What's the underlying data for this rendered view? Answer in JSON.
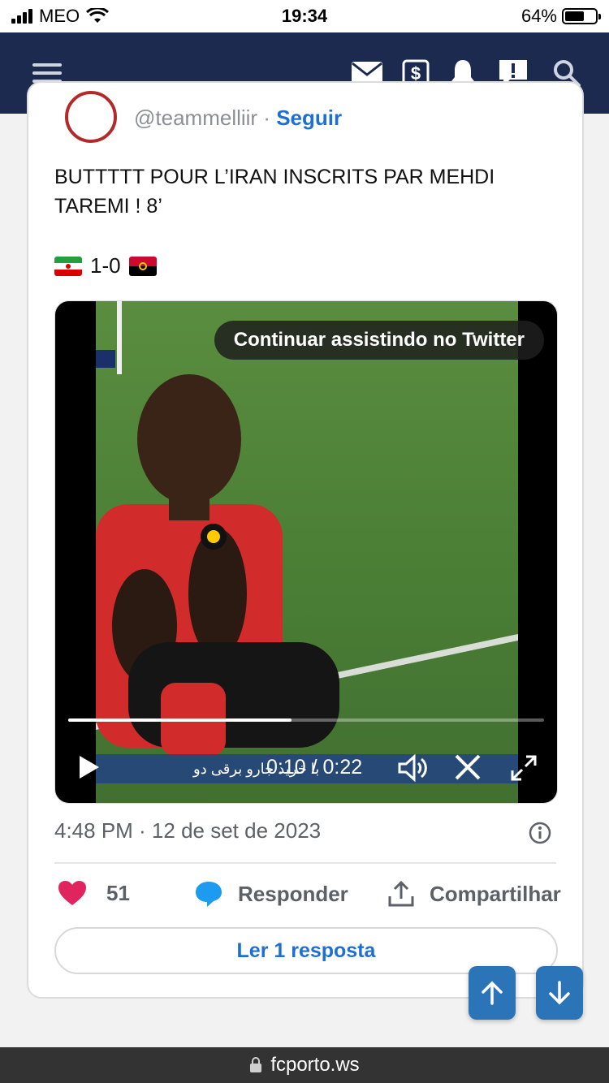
{
  "status_bar": {
    "carrier": "MEO",
    "time": "19:34",
    "battery": "64%"
  },
  "navbar": {
    "icons": [
      "menu-icon",
      "mail-icon",
      "dollar-icon",
      "bell-icon",
      "alert-icon",
      "search-icon"
    ]
  },
  "tweet": {
    "handle": "@teammelliir",
    "separator": " · ",
    "follow_label": "Seguir",
    "text": "BUTTTTT POUR L’IRAN INSCRITS PAR MEHDI TAREMI ! 8’",
    "score": "1-0",
    "date": "4:48 PM · 12 de set de 2023",
    "likes": "51",
    "reply_label": "Responder",
    "share_label": "Compartilhar",
    "read_replies_label": "Ler 1 resposta"
  },
  "video": {
    "continue_label": "Continuar assistindo no Twitter",
    "time": "0:10 / 0:22",
    "progress": 0.47,
    "banner_text": "با خرید جارو برقی دو"
  },
  "url_bar": {
    "domain": "fcporto.ws"
  },
  "colors": {
    "navbar": "#1c2a4f",
    "accent": "#1d6fd6",
    "heart": "#e0245e",
    "scroll_button": "#2b74b8"
  }
}
